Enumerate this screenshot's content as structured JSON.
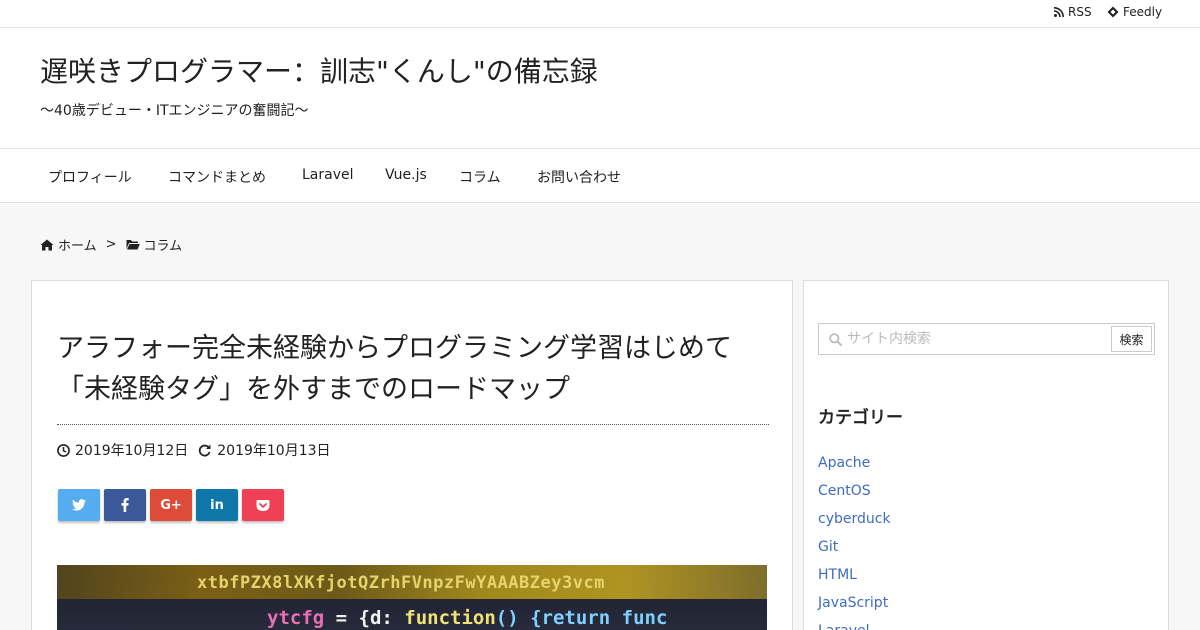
{
  "topbar": {
    "rss_label": "RSS",
    "feedly_label": "Feedly",
    "rss_icon": "rss-icon",
    "feedly_icon": "feedly-icon"
  },
  "header": {
    "site_title": "遅咲きプログラマー：訓志\"くんし\"の備忘録",
    "tagline": "〜40歳デビュー・ITエンジニアの奮闘記〜"
  },
  "nav": {
    "items": [
      {
        "label": "プロフィール"
      },
      {
        "label": "コマンドまとめ"
      },
      {
        "label": "Laravel"
      },
      {
        "label": "Vue.js"
      },
      {
        "label": "コラム"
      },
      {
        "label": "お問い合わせ"
      }
    ]
  },
  "breadcrumb": {
    "home_label": "ホーム",
    "separator": ">",
    "category_label": "コラム",
    "home_icon": "home-icon",
    "category_icon": "folder-open-icon"
  },
  "article": {
    "title": "アラフォー完全未経験からプログラミング学習はじめて「未経験タグ」を外すまでのロードマップ",
    "published_date": "2019年10月12日",
    "updated_date": "2019年10月13日",
    "published_icon": "clock-icon",
    "updated_icon": "refresh-icon",
    "share_buttons": [
      {
        "network": "twitter",
        "icon": "twitter-icon",
        "color": "#55acee"
      },
      {
        "network": "facebook",
        "icon": "facebook-icon",
        "color": "#3b5998"
      },
      {
        "network": "google-plus",
        "icon": "google-plus-icon",
        "label": "G+",
        "color": "#dd4b39"
      },
      {
        "network": "linkedin",
        "icon": "linkedin-icon",
        "label": "in",
        "color": "#0e76a8"
      },
      {
        "network": "pocket",
        "icon": "pocket-icon",
        "color": "#ef4056"
      }
    ],
    "eyecatch": {
      "code_line_1": "xtbfPZX8lXKfjotQZrhFVnpzFwYAAABZey3vcm",
      "code_line_2_a": "ytcfg",
      "code_line_2_b": " = {d: ",
      "code_line_2_c": "function",
      "code_line_2_d": "() {return func"
    }
  },
  "sidebar": {
    "search": {
      "placeholder": "サイト内検索",
      "button_label": "検索",
      "icon": "search-icon"
    },
    "categories": {
      "title": "カテゴリー",
      "items": [
        {
          "label": "Apache"
        },
        {
          "label": "CentOS"
        },
        {
          "label": "cyberduck"
        },
        {
          "label": "Git"
        },
        {
          "label": "HTML"
        },
        {
          "label": "JavaScript"
        },
        {
          "label": "Laravel"
        }
      ]
    }
  },
  "colors": {
    "link": "#3f6bc2",
    "text": "#222222",
    "page_background": "#f7f7f7"
  }
}
